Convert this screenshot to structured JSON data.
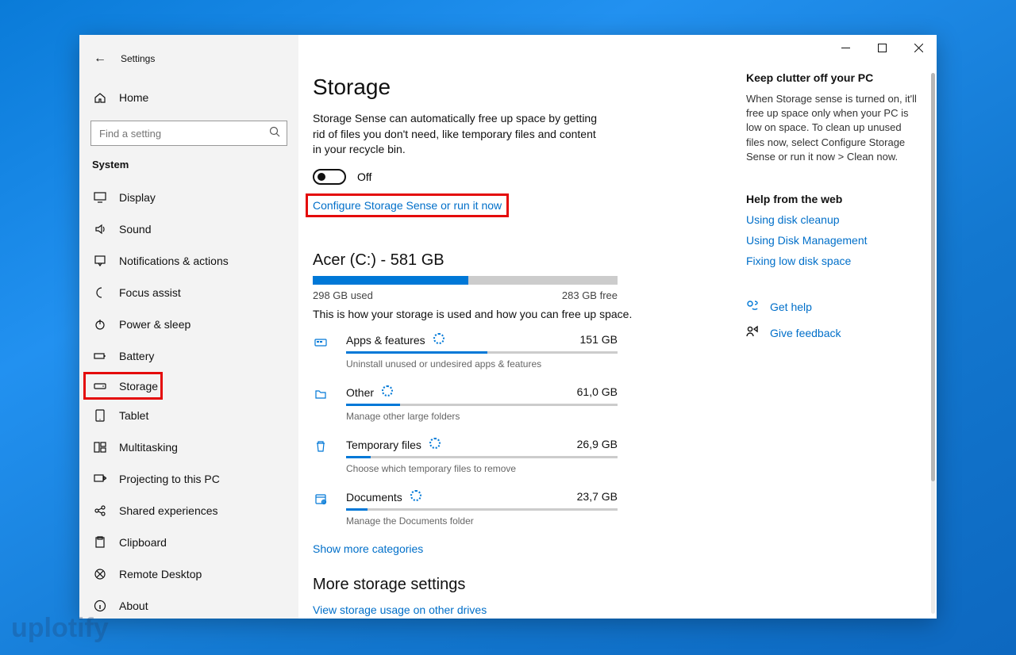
{
  "window": {
    "back_label": "Settings"
  },
  "sidebar": {
    "home": "Home",
    "search_placeholder": "Find a setting",
    "section": "System",
    "items": [
      {
        "label": "Display",
        "icon": "monitor"
      },
      {
        "label": "Sound",
        "icon": "sound"
      },
      {
        "label": "Notifications & actions",
        "icon": "notification"
      },
      {
        "label": "Focus assist",
        "icon": "moon"
      },
      {
        "label": "Power & sleep",
        "icon": "power"
      },
      {
        "label": "Battery",
        "icon": "battery"
      },
      {
        "label": "Storage",
        "icon": "drive",
        "selected": true
      },
      {
        "label": "Tablet",
        "icon": "tablet"
      },
      {
        "label": "Multitasking",
        "icon": "multitask"
      },
      {
        "label": "Projecting to this PC",
        "icon": "project"
      },
      {
        "label": "Shared experiences",
        "icon": "share"
      },
      {
        "label": "Clipboard",
        "icon": "clipboard"
      },
      {
        "label": "Remote Desktop",
        "icon": "remote"
      },
      {
        "label": "About",
        "icon": "info"
      }
    ]
  },
  "main": {
    "title": "Storage",
    "sense": "Storage Sense can automatically free up space by getting rid of files you don't need, like temporary files and content in your recycle bin.",
    "toggle": "Off",
    "configure": "Configure Storage Sense or run it now",
    "drive": "Acer (C:) - 581 GB",
    "used": "298 GB used",
    "free": "283 GB free",
    "used_pct": 51,
    "how": "This is how your storage is used and how you can free up space.",
    "cats": [
      {
        "name": "Apps & features",
        "size": "151 GB",
        "sub": "Uninstall unused or undesired apps & features",
        "pct": 52,
        "icon": "apps"
      },
      {
        "name": "Other",
        "size": "61,0 GB",
        "sub": "Manage other large folders",
        "pct": 20,
        "icon": "folder"
      },
      {
        "name": "Temporary files",
        "size": "26,9 GB",
        "sub": "Choose which temporary files to remove",
        "pct": 9,
        "icon": "trash"
      },
      {
        "name": "Documents",
        "size": "23,7 GB",
        "sub": "Manage the Documents folder",
        "pct": 8,
        "icon": "doc"
      }
    ],
    "more_cat": "Show more categories",
    "more_head": "More storage settings",
    "more_link": "View storage usage on other drives"
  },
  "aside": {
    "h1": "Keep clutter off your PC",
    "p": "When Storage sense is turned on, it'll free up space only when your PC is low on space. To clean up unused files now, select Configure Storage Sense or run it now > Clean now.",
    "h2": "Help from the web",
    "links": [
      "Using disk cleanup",
      "Using Disk Management",
      "Fixing low disk space"
    ],
    "help": "Get help",
    "feedback": "Give feedback"
  },
  "watermark": "uplotify"
}
